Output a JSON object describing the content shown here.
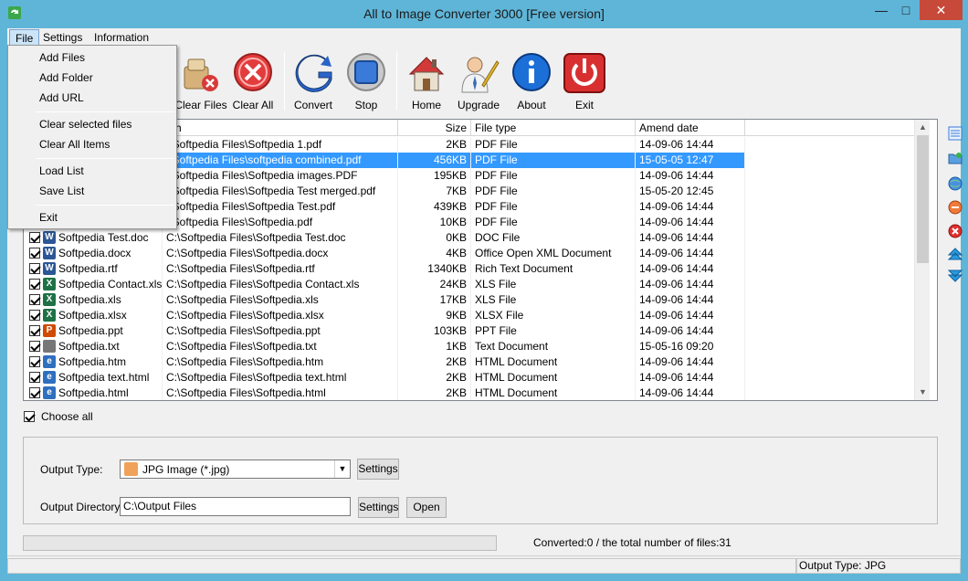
{
  "window": {
    "title": "All to Image Converter 3000 [Free version]",
    "controls": {
      "minimize": "—",
      "maximize": "□",
      "close": "✕"
    }
  },
  "menubar": [
    "File",
    "Settings",
    "Information"
  ],
  "file_menu": {
    "items": [
      {
        "label": "Add Files"
      },
      {
        "label": "Add Folder"
      },
      {
        "label": "Add URL"
      },
      {
        "label": "Clear selected files"
      },
      {
        "label": "Clear All Items"
      },
      {
        "label": "Load List"
      },
      {
        "label": "Save List"
      },
      {
        "label": "Exit"
      }
    ]
  },
  "toolbar": {
    "clear_files": "Clear Files",
    "clear_all": "Clear All",
    "convert": "Convert",
    "stop": "Stop",
    "home": "Home",
    "upgrade": "Upgrade",
    "about": "About",
    "exit": "Exit"
  },
  "list": {
    "columns": {
      "path": "ath",
      "size": "Size",
      "type": "File type",
      "date": "Amend date"
    },
    "rows": [
      {
        "name": "",
        "path": ":\\Softpedia Files\\Softpedia 1.pdf",
        "size": "2KB",
        "type": "PDF File",
        "date": "14-09-06 14:44",
        "icon": "pdf"
      },
      {
        "name": "",
        "path": ":\\Softpedia Files\\softpedia combined.pdf",
        "size": "456KB",
        "type": "PDF File",
        "date": "15-05-05 12:47",
        "icon": "pdf",
        "selected": true
      },
      {
        "name": "",
        "path": ":\\Softpedia Files\\Softpedia images.PDF",
        "size": "195KB",
        "type": "PDF File",
        "date": "14-09-06 14:44",
        "icon": "pdf"
      },
      {
        "name": "",
        "path": ":\\Softpedia Files\\Softpedia Test merged.pdf",
        "size": "7KB",
        "type": "PDF File",
        "date": "15-05-20 12:45",
        "icon": "pdf"
      },
      {
        "name": "",
        "path": ":\\Softpedia Files\\Softpedia Test.pdf",
        "size": "439KB",
        "type": "PDF File",
        "date": "14-09-06 14:44",
        "icon": "pdf"
      },
      {
        "name": "",
        "path": ":\\Softpedia Files\\Softpedia.pdf",
        "size": "10KB",
        "type": "PDF File",
        "date": "14-09-06 14:44",
        "icon": "pdf"
      },
      {
        "name": "Softpedia Test.doc",
        "path": "C:\\Softpedia Files\\Softpedia Test.doc",
        "size": "0KB",
        "type": "DOC File",
        "date": "14-09-06 14:44",
        "icon": "word"
      },
      {
        "name": "Softpedia.docx",
        "path": "C:\\Softpedia Files\\Softpedia.docx",
        "size": "4KB",
        "type": "Office Open XML Document",
        "date": "14-09-06 14:44",
        "icon": "word"
      },
      {
        "name": "Softpedia.rtf",
        "path": "C:\\Softpedia Files\\Softpedia.rtf",
        "size": "1340KB",
        "type": "Rich Text Document",
        "date": "14-09-06 14:44",
        "icon": "word"
      },
      {
        "name": "Softpedia Contact.xls",
        "path": "C:\\Softpedia Files\\Softpedia Contact.xls",
        "size": "24KB",
        "type": "XLS File",
        "date": "14-09-06 14:44",
        "icon": "excel"
      },
      {
        "name": "Softpedia.xls",
        "path": "C:\\Softpedia Files\\Softpedia.xls",
        "size": "17KB",
        "type": "XLS File",
        "date": "14-09-06 14:44",
        "icon": "excel"
      },
      {
        "name": "Softpedia.xlsx",
        "path": "C:\\Softpedia Files\\Softpedia.xlsx",
        "size": "9KB",
        "type": "XLSX File",
        "date": "14-09-06 14:44",
        "icon": "excel"
      },
      {
        "name": "Softpedia.ppt",
        "path": "C:\\Softpedia Files\\Softpedia.ppt",
        "size": "103KB",
        "type": "PPT File",
        "date": "14-09-06 14:44",
        "icon": "ppt"
      },
      {
        "name": "Softpedia.txt",
        "path": "C:\\Softpedia Files\\Softpedia.txt",
        "size": "1KB",
        "type": "Text Document",
        "date": "15-05-16 09:20",
        "icon": "txt"
      },
      {
        "name": "Softpedia.htm",
        "path": "C:\\Softpedia Files\\Softpedia.htm",
        "size": "2KB",
        "type": "HTML Document",
        "date": "14-09-06 14:44",
        "icon": "html"
      },
      {
        "name": "Softpedia text.html",
        "path": "C:\\Softpedia Files\\Softpedia text.html",
        "size": "2KB",
        "type": "HTML Document",
        "date": "14-09-06 14:44",
        "icon": "html"
      },
      {
        "name": "Softpedia.html",
        "path": "C:\\Softpedia Files\\Softpedia.html",
        "size": "2KB",
        "type": "HTML Document",
        "date": "14-09-06 14:44",
        "icon": "html"
      }
    ]
  },
  "choose_all": "Choose all",
  "output": {
    "type_label": "Output Type:",
    "type_value": "JPG Image (*.jpg)",
    "settings": "Settings",
    "dir_label": "Output Directory:",
    "dir_value": "C:\\Output Files",
    "open": "Open"
  },
  "progress": {
    "fraction": 0
  },
  "status": {
    "converted": "Converted:0  /  the total number of files:31",
    "output_type": "Output Type: JPG"
  },
  "colors": {
    "titlebar": "#5fb5d8",
    "selection": "#3399ff",
    "close": "#c7493a"
  },
  "icon_colors": {
    "pdf": "#cc3333",
    "word": "#2b5797",
    "excel": "#1e7145",
    "ppt": "#d04a02",
    "txt": "#777777",
    "html": "#2f6fbf"
  }
}
